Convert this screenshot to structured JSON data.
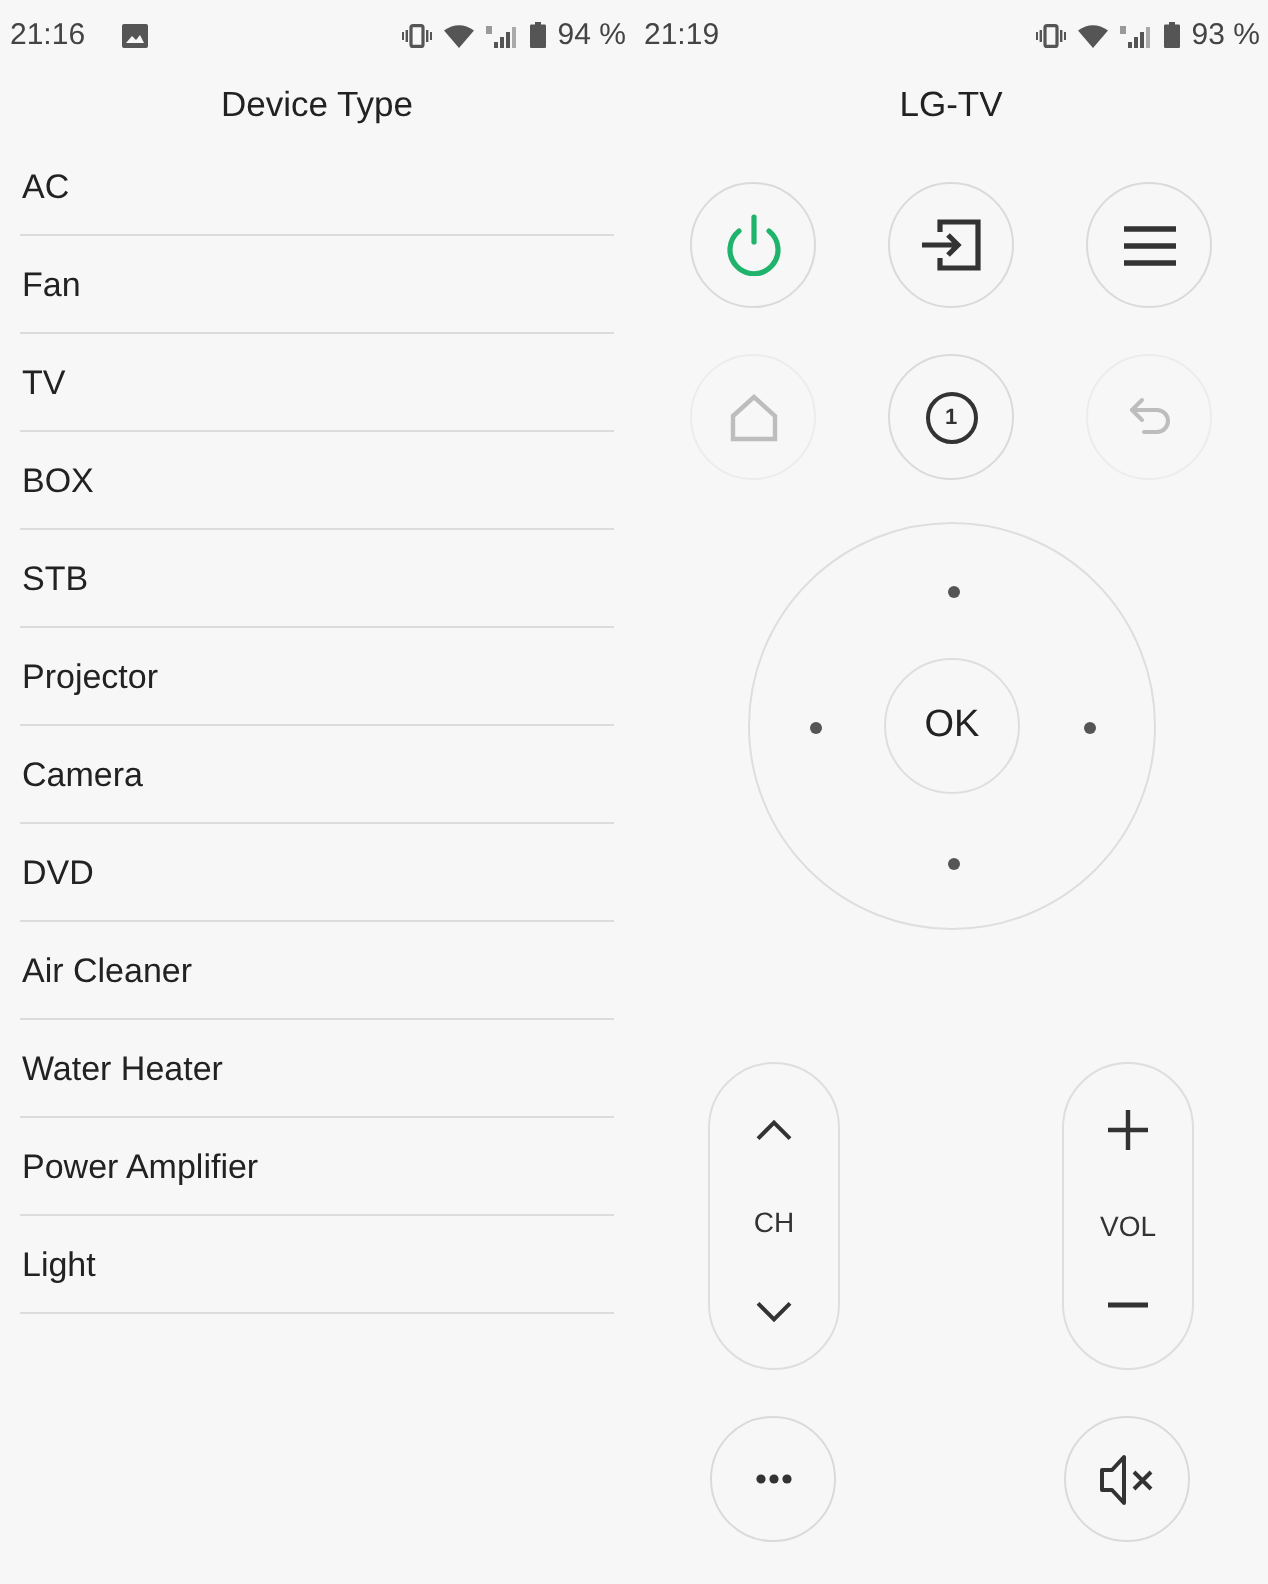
{
  "left_screen": {
    "status_bar": {
      "time": "21:16",
      "notifications": [
        {
          "kind": "image"
        }
      ],
      "battery": "94 %"
    },
    "title": "Device Type",
    "device_types": [
      "AC",
      "Fan",
      "TV",
      "BOX",
      "STB",
      "Projector",
      "Camera",
      "DVD",
      "Air Cleaner",
      "Water Heater",
      "Power Amplifier",
      "Light"
    ]
  },
  "right_screen": {
    "status_bar": {
      "time": "21:19",
      "battery": "93 %"
    },
    "title": "LG-TV",
    "buttons": [
      {
        "kind": "power",
        "disabled": false
      },
      {
        "kind": "input",
        "disabled": false
      },
      {
        "kind": "menu",
        "disabled": false
      },
      {
        "kind": "home",
        "disabled": true
      },
      {
        "kind": "number",
        "label": "1",
        "disabled": false
      },
      {
        "kind": "back",
        "disabled": true
      }
    ],
    "dpad": {
      "center_label": "OK"
    },
    "rockers": [
      {
        "kind": "channel",
        "label": "CH"
      },
      {
        "kind": "volume",
        "label": "VOL"
      }
    ],
    "bottom_buttons": [
      {
        "kind": "more"
      },
      {
        "kind": "mute"
      }
    ]
  }
}
